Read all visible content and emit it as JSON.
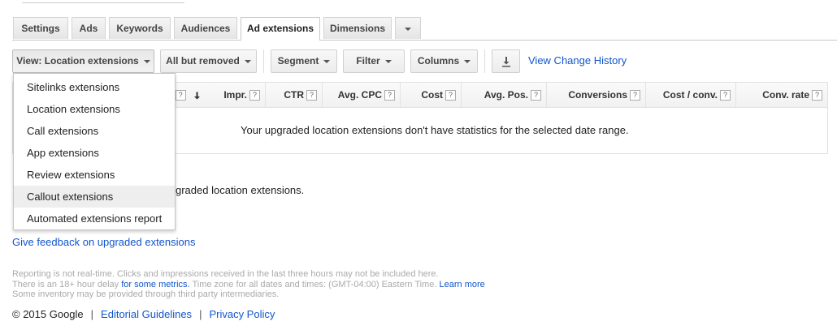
{
  "tabs": [
    {
      "label": "Settings"
    },
    {
      "label": "Ads"
    },
    {
      "label": "Keywords"
    },
    {
      "label": "Audiences"
    },
    {
      "label": "Ad extensions"
    },
    {
      "label": "Dimensions"
    }
  ],
  "toolbar": {
    "view_label": "View: Location extensions",
    "filter_status_label": "All but removed",
    "segment_label": "Segment",
    "filter_label": "Filter",
    "columns_label": "Columns",
    "change_history_link": "View Change History"
  },
  "table": {
    "columns": [
      {
        "label": "Impr."
      },
      {
        "label": "CTR"
      },
      {
        "label": "Avg. CPC"
      },
      {
        "label": "Cost"
      },
      {
        "label": "Avg. Pos."
      },
      {
        "label": "Conversions"
      },
      {
        "label": "Cost / conv."
      },
      {
        "label": "Conv. rate"
      }
    ],
    "help_glyph": "?",
    "empty_message": "Your upgraded location extensions don't have statistics for the selected date range."
  },
  "dropdown": {
    "items": [
      {
        "label": "Sitelinks extensions"
      },
      {
        "label": "Location extensions"
      },
      {
        "label": "Call extensions"
      },
      {
        "label": "App extensions"
      },
      {
        "label": "Review extensions"
      },
      {
        "label": "Callout extensions"
      },
      {
        "label": "Automated extensions report"
      }
    ]
  },
  "below_menu_text": "graded location extensions.",
  "feedback_link": "Give feedback on upgraded extensions",
  "notes": {
    "line1": "Reporting is not real-time. Clicks and impressions received in the last three hours may not be included here.",
    "line2_before": "There is an 18+ hour delay ",
    "line2_link1": "for some metrics.",
    "line2_after": " Time zone for all dates and times: (GMT-04:00) Eastern Time. ",
    "line2_link2": "Learn more",
    "line3": "Some inventory may be provided through third party intermediaries."
  },
  "footer": {
    "copyright": "© 2015 Google",
    "separator": "|",
    "editorial_link": "Editorial Guidelines",
    "privacy_link": "Privacy Policy"
  },
  "colors": {
    "link": "#1155cc"
  }
}
